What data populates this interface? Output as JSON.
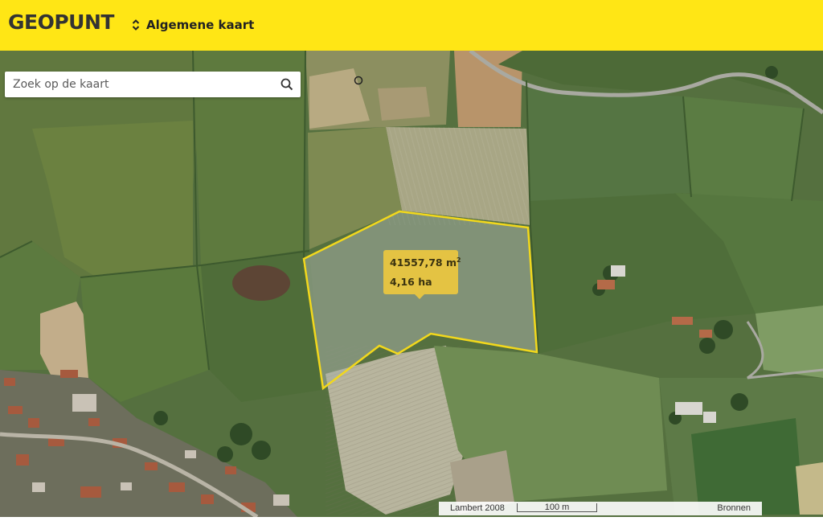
{
  "header": {
    "logo": "GEOPUNT",
    "map_selector_label": "Algemene kaart",
    "accent_color": "#ffe615"
  },
  "search": {
    "placeholder": "Zoek op de kaart"
  },
  "measurement": {
    "area_m2": "41557,78 m",
    "area_unit_sup": "2",
    "area_ha": "4,16 ha",
    "polygon_color": "#f2d81c"
  },
  "scalebar": {
    "projection": "Lambert 2008",
    "distance": "100 m",
    "sources_label": "Bronnen"
  },
  "icons": {
    "search": "search-icon",
    "selector": "up-down-chevron-icon"
  }
}
